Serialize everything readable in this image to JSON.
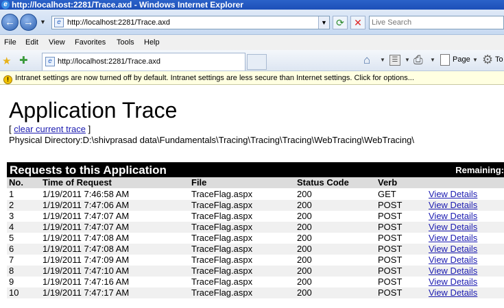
{
  "window": {
    "title": "http://localhost:2281/Trace.axd - Windows Internet Explorer"
  },
  "nav": {
    "url": "http://localhost:2281/Trace.axd",
    "search_placeholder": "Live Search"
  },
  "menu": [
    "File",
    "Edit",
    "View",
    "Favorites",
    "Tools",
    "Help"
  ],
  "tab": {
    "label": "http://localhost:2281/Trace.axd"
  },
  "commands": {
    "page": "Page",
    "tools": "To"
  },
  "infobar": {
    "text": "Intranet settings are now turned off by default. Intranet settings are less secure than Internet settings. Click for options..."
  },
  "page": {
    "title": "Application Trace",
    "clear_prefix": "[",
    "clear_link": "clear current trace",
    "clear_suffix": "]",
    "physical_directory": "Physical Directory:D:\\shivprasad data\\Fundamentals\\Tracing\\Tracing\\Tracing\\WebTracing\\WebTracing\\"
  },
  "requests": {
    "title": "Requests to this Application",
    "remaining": "Remaining:",
    "columns": {
      "no": "No.",
      "time": "Time of Request",
      "file": "File",
      "status": "Status Code",
      "verb": "Verb"
    },
    "rows": [
      {
        "no": "1",
        "time": "1/19/2011 7:46:58 AM",
        "file": "TraceFlag.aspx",
        "status": "200",
        "verb": "GET",
        "link": "View Details"
      },
      {
        "no": "2",
        "time": "1/19/2011 7:47:06 AM",
        "file": "TraceFlag.aspx",
        "status": "200",
        "verb": "POST",
        "link": "View Details"
      },
      {
        "no": "3",
        "time": "1/19/2011 7:47:07 AM",
        "file": "TraceFlag.aspx",
        "status": "200",
        "verb": "POST",
        "link": "View Details"
      },
      {
        "no": "4",
        "time": "1/19/2011 7:47:07 AM",
        "file": "TraceFlag.aspx",
        "status": "200",
        "verb": "POST",
        "link": "View Details"
      },
      {
        "no": "5",
        "time": "1/19/2011 7:47:08 AM",
        "file": "TraceFlag.aspx",
        "status": "200",
        "verb": "POST",
        "link": "View Details"
      },
      {
        "no": "6",
        "time": "1/19/2011 7:47:08 AM",
        "file": "TraceFlag.aspx",
        "status": "200",
        "verb": "POST",
        "link": "View Details"
      },
      {
        "no": "7",
        "time": "1/19/2011 7:47:09 AM",
        "file": "TraceFlag.aspx",
        "status": "200",
        "verb": "POST",
        "link": "View Details"
      },
      {
        "no": "8",
        "time": "1/19/2011 7:47:10 AM",
        "file": "TraceFlag.aspx",
        "status": "200",
        "verb": "POST",
        "link": "View Details"
      },
      {
        "no": "9",
        "time": "1/19/2011 7:47:16 AM",
        "file": "TraceFlag.aspx",
        "status": "200",
        "verb": "POST",
        "link": "View Details"
      },
      {
        "no": "10",
        "time": "1/19/2011 7:47:17 AM",
        "file": "TraceFlag.aspx",
        "status": "200",
        "verb": "POST",
        "link": "View Details"
      }
    ]
  }
}
